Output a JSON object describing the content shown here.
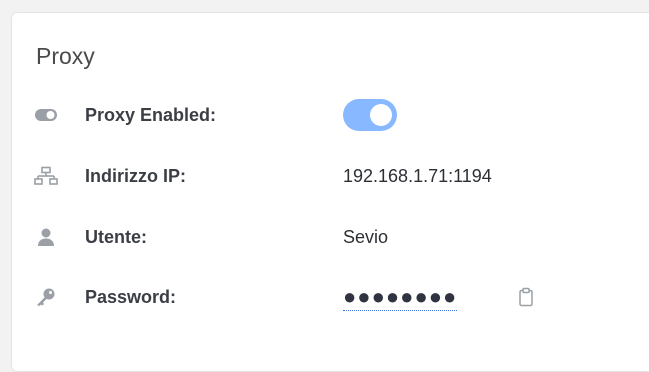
{
  "card": {
    "title": "Proxy"
  },
  "rows": {
    "proxy_enabled": {
      "label": "Proxy Enabled:",
      "icon": "toggle-icon",
      "enabled": true
    },
    "ip_address": {
      "label": "Indirizzo IP:",
      "icon": "network-icon",
      "value": "192.168.1.71:1194"
    },
    "user": {
      "label": "Utente:",
      "icon": "user-icon",
      "value": "Sevio"
    },
    "password": {
      "label": "Password:",
      "icon": "key-icon",
      "masked_value": "●●●●●●●●",
      "copy_icon": "clipboard-icon"
    }
  },
  "colors": {
    "toggle_on": "#88b8ff",
    "icon": "#9aa0a6",
    "label": "#3b3f45",
    "value": "#2c2f33",
    "link_underline": "#3b6fd3"
  }
}
